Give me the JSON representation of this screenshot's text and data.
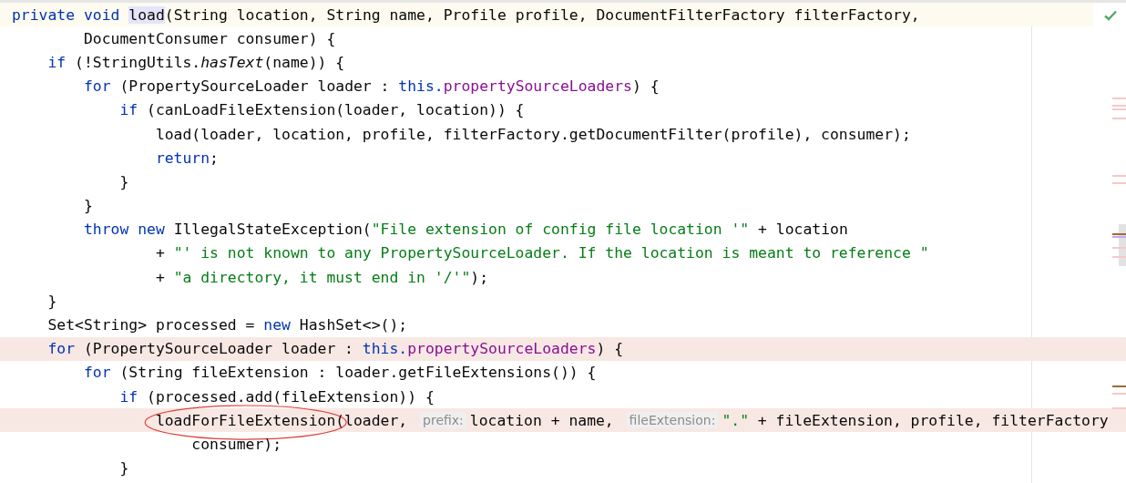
{
  "editor": {
    "lines": [
      {
        "current": true,
        "marked": false,
        "tokens": [
          {
            "kind": "keyword",
            "text": "private void "
          },
          {
            "kind": "plain",
            "text": "load",
            "highlighted": true
          },
          {
            "kind": "plain",
            "text": "(String location, String name, Profile profile, DocumentFilterFactory filterFactory,"
          }
        ]
      },
      {
        "current": false,
        "marked": false,
        "tokens": [
          {
            "kind": "plain",
            "text": "        DocumentConsumer consumer) {"
          }
        ]
      },
      {
        "current": false,
        "marked": false,
        "tokens": [
          {
            "kind": "keyword",
            "text": "    if"
          },
          {
            "kind": "plain",
            "text": " (!StringUtils."
          },
          {
            "kind": "static",
            "text": "hasText"
          },
          {
            "kind": "plain",
            "text": "(name)) {"
          }
        ]
      },
      {
        "current": false,
        "marked": false,
        "tokens": [
          {
            "kind": "keyword",
            "text": "        for"
          },
          {
            "kind": "plain",
            "text": " (PropertySourceLoader loader : "
          },
          {
            "kind": "keyword",
            "text": "this."
          },
          {
            "kind": "field",
            "text": "propertySourceLoaders"
          },
          {
            "kind": "plain",
            "text": ") {"
          }
        ]
      },
      {
        "current": false,
        "marked": false,
        "tokens": [
          {
            "kind": "keyword",
            "text": "            if"
          },
          {
            "kind": "plain",
            "text": " (canLoadFileExtension(loader, location)) {"
          }
        ]
      },
      {
        "current": false,
        "marked": false,
        "tokens": [
          {
            "kind": "plain",
            "text": "                load(loader, location, profile, filterFactory.getDocumentFilter(profile), consumer);"
          }
        ]
      },
      {
        "current": false,
        "marked": false,
        "tokens": [
          {
            "kind": "keyword",
            "text": "                return"
          },
          {
            "kind": "plain",
            "text": ";"
          }
        ]
      },
      {
        "current": false,
        "marked": false,
        "tokens": [
          {
            "kind": "plain",
            "text": "            }"
          }
        ]
      },
      {
        "current": false,
        "marked": false,
        "tokens": [
          {
            "kind": "plain",
            "text": "        }"
          }
        ]
      },
      {
        "current": false,
        "marked": false,
        "tokens": [
          {
            "kind": "keyword",
            "text": "        throw new"
          },
          {
            "kind": "plain",
            "text": " IllegalStateException("
          },
          {
            "kind": "string",
            "text": "\"File extension of config file location '\""
          },
          {
            "kind": "plain",
            "text": " + location"
          }
        ]
      },
      {
        "current": false,
        "marked": false,
        "tokens": [
          {
            "kind": "plain",
            "text": "                + "
          },
          {
            "kind": "string",
            "text": "\"' is not known to any PropertySourceLoader. If the location is meant to reference \""
          }
        ]
      },
      {
        "current": false,
        "marked": false,
        "tokens": [
          {
            "kind": "plain",
            "text": "                + "
          },
          {
            "kind": "string",
            "text": "\"a directory, it must end in '/'\""
          },
          {
            "kind": "plain",
            "text": ");"
          }
        ]
      },
      {
        "current": false,
        "marked": false,
        "tokens": [
          {
            "kind": "plain",
            "text": "    }"
          }
        ]
      },
      {
        "current": false,
        "marked": false,
        "tokens": [
          {
            "kind": "plain",
            "text": "    Set<String> processed = "
          },
          {
            "kind": "keyword",
            "text": "new"
          },
          {
            "kind": "plain",
            "text": " HashSet<>();"
          }
        ]
      },
      {
        "current": false,
        "marked": true,
        "tokens": [
          {
            "kind": "keyword",
            "text": "    for"
          },
          {
            "kind": "plain",
            "text": " (PropertySourceLoader loader : "
          },
          {
            "kind": "keyword",
            "text": "this."
          },
          {
            "kind": "field",
            "text": "propertySourceLoaders"
          },
          {
            "kind": "plain",
            "text": ") {"
          }
        ]
      },
      {
        "current": false,
        "marked": false,
        "tokens": [
          {
            "kind": "keyword",
            "text": "        for"
          },
          {
            "kind": "plain",
            "text": " (String fileExtension : loader.getFileExtensions()) {"
          }
        ]
      },
      {
        "current": false,
        "marked": false,
        "tokens": [
          {
            "kind": "keyword",
            "text": "            if"
          },
          {
            "kind": "plain",
            "text": " (processed.add(fileExtension)) {"
          }
        ]
      },
      {
        "current": false,
        "marked": true,
        "tokens": [
          {
            "kind": "plain",
            "text": "                loadForFileExtension",
            "circled": true
          },
          {
            "kind": "plain",
            "text": "(loader, "
          },
          {
            "kind": "hint",
            "text": "prefix:"
          },
          {
            "kind": "plain",
            "text": "location + name, "
          },
          {
            "kind": "hint",
            "text": "fileExtension:"
          },
          {
            "kind": "string",
            "text": "\".\""
          },
          {
            "kind": "plain",
            "text": " + fileExtension, profile, filterFactory"
          }
        ]
      },
      {
        "current": false,
        "marked": false,
        "tokens": [
          {
            "kind": "plain",
            "text": "                    consumer);"
          }
        ]
      },
      {
        "current": false,
        "marked": false,
        "tokens": [
          {
            "kind": "plain",
            "text": "            }"
          }
        ]
      }
    ]
  }
}
